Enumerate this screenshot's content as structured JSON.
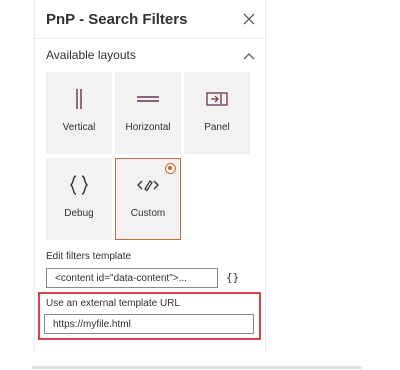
{
  "panel": {
    "title": "PnP - Search Filters"
  },
  "section": {
    "title": "Available layouts"
  },
  "layouts": [
    {
      "label": "Vertical",
      "icon": "vertical-layout-icon",
      "selected": false
    },
    {
      "label": "Horizontal",
      "icon": "horizontal-layout-icon",
      "selected": false
    },
    {
      "label": "Panel",
      "icon": "panel-layout-icon",
      "selected": false
    },
    {
      "label": "Debug",
      "icon": "braces-icon",
      "selected": false
    },
    {
      "label": "Custom",
      "icon": "custom-code-icon",
      "selected": true
    }
  ],
  "edit_template": {
    "label": "Edit filters template",
    "value": "<content id=\"data-content\">...",
    "button": "{}"
  },
  "external_template": {
    "label": "Use an external template URL",
    "value": "https://myfile.html"
  },
  "colors": {
    "accent": "#d4602d",
    "tile_background": "#f3f2f1",
    "highlight": "#d9434b",
    "tile_icon": "#6b2f52"
  }
}
